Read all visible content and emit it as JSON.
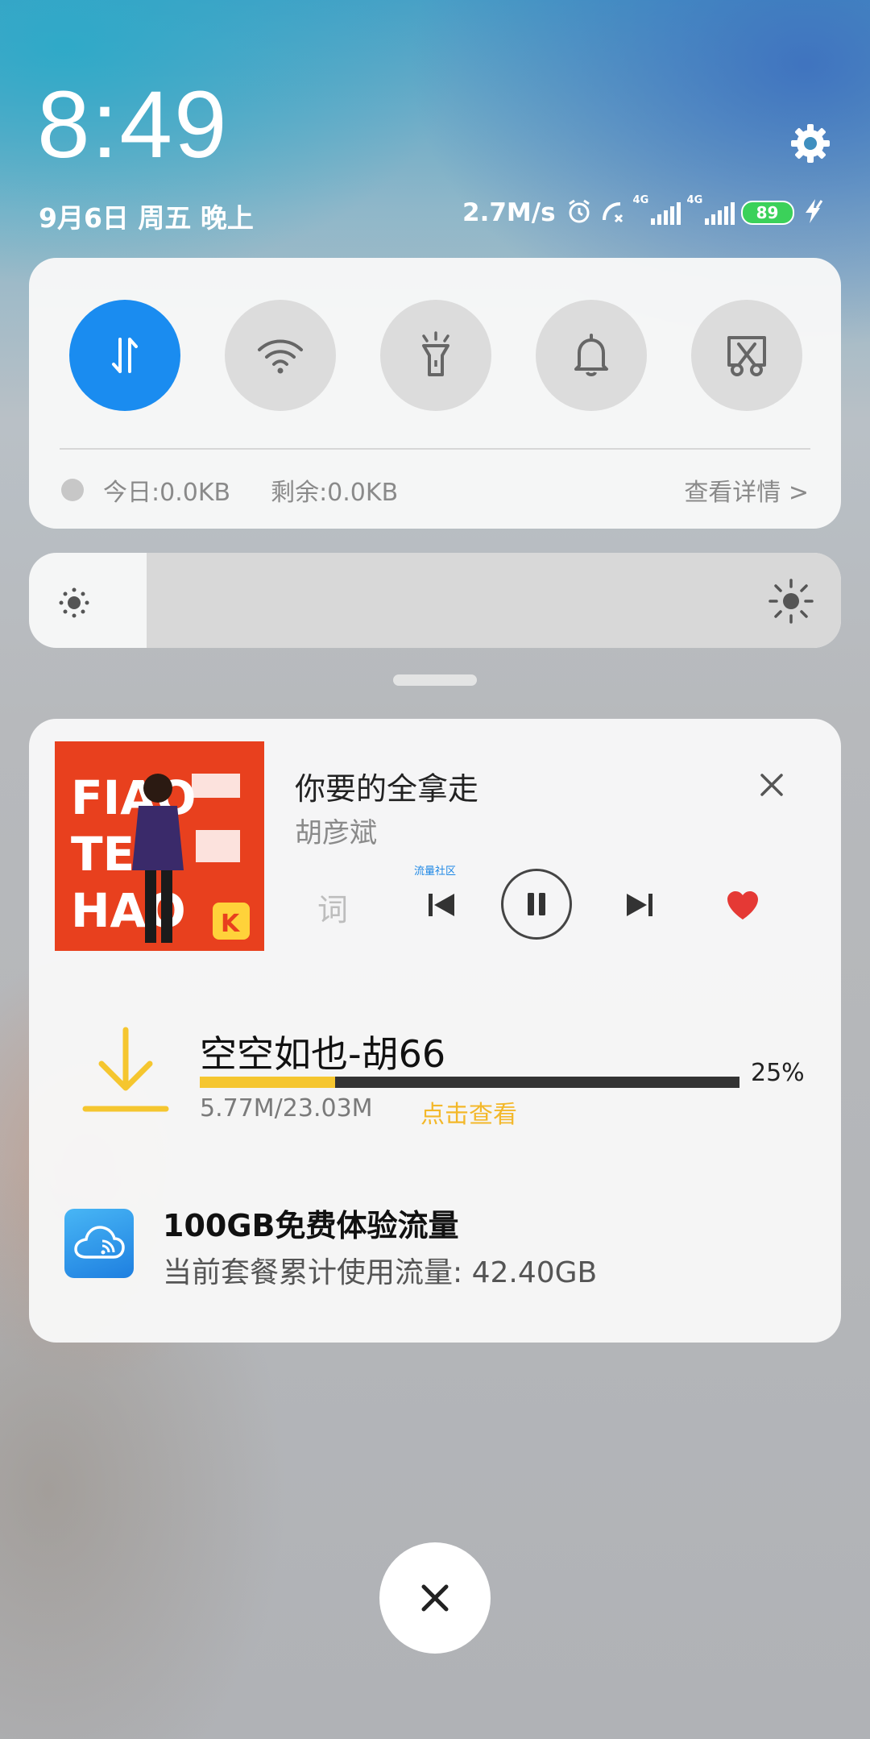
{
  "header": {
    "time": "8:49",
    "date": "9月6日 周五 晚上",
    "net_speed": "2.7M/s",
    "signal1_label": "4G",
    "signal2_label": "4G",
    "battery": "89",
    "icons": [
      "alarm-icon",
      "call-forward-icon",
      "signal-icon",
      "battery-icon",
      "charging-icon",
      "settings-icon"
    ]
  },
  "quick_settings": {
    "toggles": [
      {
        "name": "mobile-data",
        "icon": "data-arrows-icon",
        "active": true
      },
      {
        "name": "wifi",
        "icon": "wifi-icon",
        "active": false
      },
      {
        "name": "flashlight",
        "icon": "flashlight-icon",
        "active": false
      },
      {
        "name": "sound",
        "icon": "bell-icon",
        "active": false
      },
      {
        "name": "screenshot",
        "icon": "screenshot-icon",
        "active": false
      }
    ],
    "today_label": "今日:0.0KB",
    "remain_label": "剩余:0.0KB",
    "detail_link": "查看详情 >"
  },
  "brightness": {
    "level": 0.0
  },
  "music": {
    "album_art_text": [
      "FIAO",
      "TE",
      "HAO"
    ],
    "song": "你要的全拿走",
    "artist": "胡彦斌",
    "lyric_button": "词",
    "tiny_label": "流量社区",
    "liked": true,
    "accent": "#e53935"
  },
  "download": {
    "title": "空空如也-胡66",
    "progress_percent": 25,
    "percent_label": "25%",
    "size": "5.77M/23.03M",
    "link": "点击查看",
    "accent": "#f5c62f"
  },
  "promo": {
    "title": "100GB免费体验流量",
    "subtitle": "当前套餐累计使用流量: 42.40GB"
  }
}
